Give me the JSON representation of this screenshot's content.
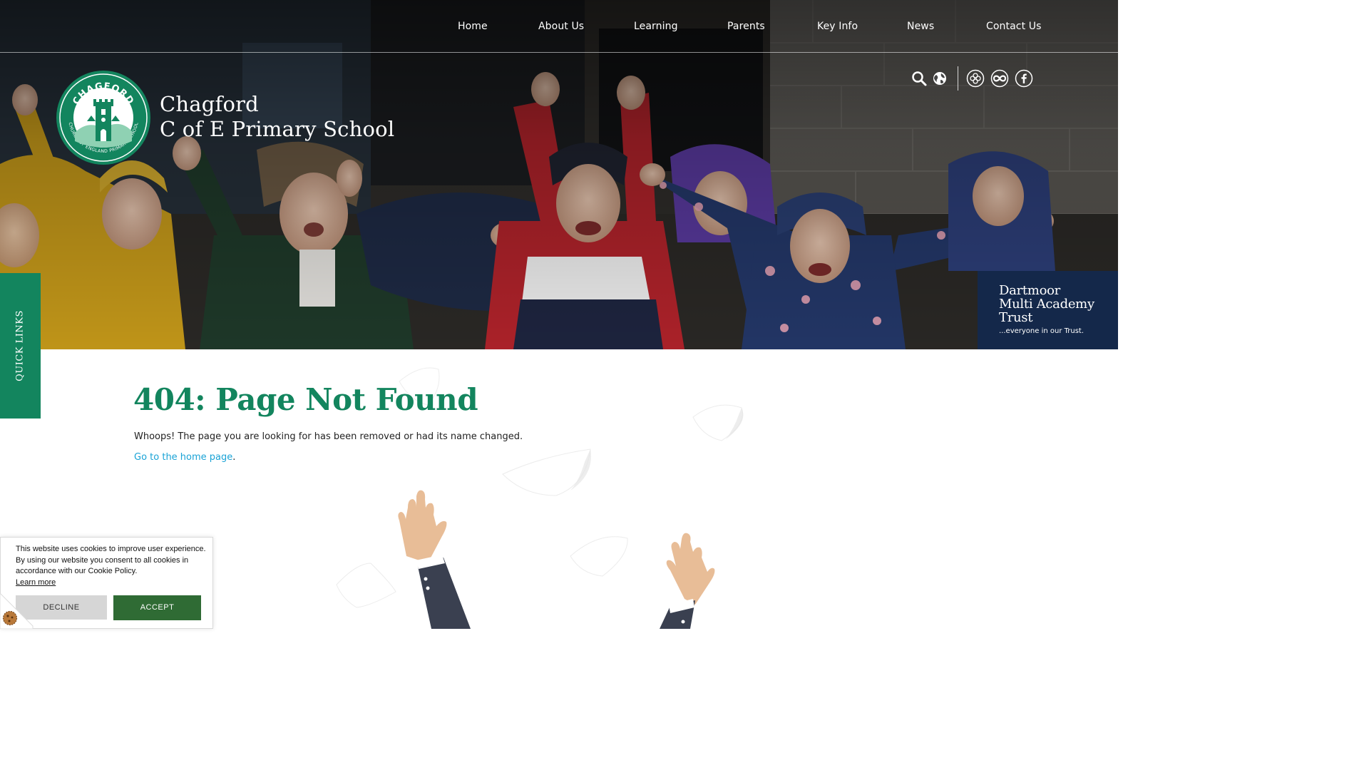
{
  "nav": {
    "items": [
      {
        "label": "Home"
      },
      {
        "label": "About Us"
      },
      {
        "label": "Learning"
      },
      {
        "label": "Parents"
      },
      {
        "label": "Key Info"
      },
      {
        "label": "News"
      },
      {
        "label": "Contact Us"
      }
    ]
  },
  "school": {
    "name_line1": "Chagford",
    "name_line2": "C of E Primary School",
    "crest_top_text": "CHAGFORD",
    "crest_ring_text": "CHURCH OF ENGLAND PRIMARY SCHOOL"
  },
  "utility_icons": [
    "search-icon",
    "globe-icon",
    "clover-icon",
    "infinity-icon",
    "facebook-icon"
  ],
  "trust": {
    "line1": "Dartmoor",
    "line2": "Multi Academy",
    "line3": "Trust",
    "tagline": "...everyone in our Trust."
  },
  "quick_links": {
    "label": "QUICK LINKS"
  },
  "content": {
    "title": "404: Page Not Found",
    "message": "Whoops! The page you are looking for has been removed or had its name changed.",
    "home_link": "Go to the home page",
    "home_suffix": "."
  },
  "cookie": {
    "text": "This website uses cookies to improve user experience. By using our website you consent to all cookies in accordance with our Cookie Policy.",
    "learn_more": "Learn more",
    "decline": "DECLINE",
    "accept": "ACCEPT"
  },
  "colors": {
    "brand_green": "#13855e",
    "trust_navy": "#14284a",
    "link_blue": "#1aa3d6",
    "accept_green": "#2f6b34"
  }
}
